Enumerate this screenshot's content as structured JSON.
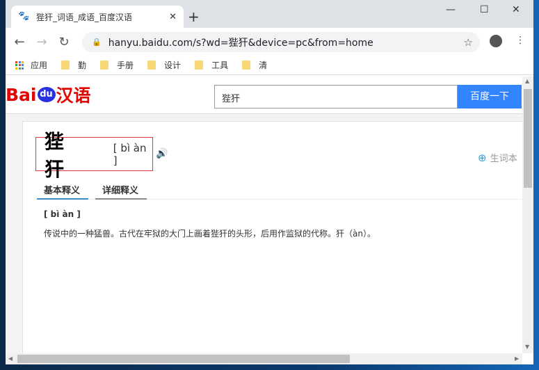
{
  "browser": {
    "tab_title": "狴犴_词语_成语_百度汉语",
    "url": "hanyu.baidu.com/s?wd=狴犴&device=pc&from=home",
    "bookmarks": [
      "应用",
      "勤",
      "手册",
      "设计",
      "工具",
      "清"
    ]
  },
  "site": {
    "logo_text": "Bai du 汉语",
    "search_value": "狴犴",
    "search_button": "百度一下"
  },
  "entry": {
    "word": "狴 犴",
    "pinyin": "[ bì àn ]",
    "vocab_label": "生词本",
    "tabs": [
      "基本释义",
      "详细释义"
    ],
    "def_pinyin": "[ bì àn ]",
    "definition": "传说中的一种猛兽。古代在牢狱的大门上画着狴犴的头形，后用作监狱的代称。犴（àn）。"
  },
  "colors": {
    "brand_red": "#e10602",
    "brand_blue": "#2932e1",
    "button_blue": "#3385ff"
  }
}
